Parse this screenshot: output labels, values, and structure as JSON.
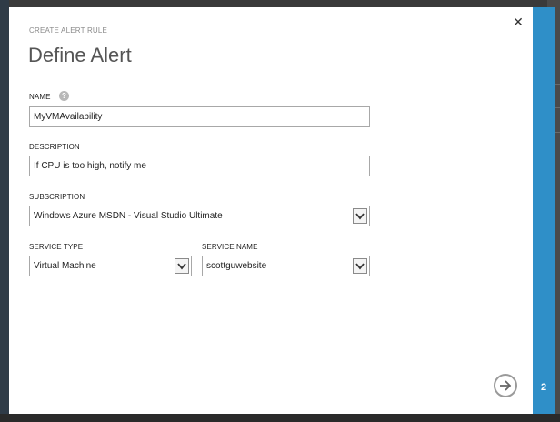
{
  "dialog": {
    "subtitle": "CREATE ALERT RULE",
    "title": "Define Alert",
    "step": "2"
  },
  "form": {
    "name": {
      "label": "NAME",
      "value": "MyVMAvailability"
    },
    "description": {
      "label": "DESCRIPTION",
      "value": "If CPU is too high, notify me"
    },
    "subscription": {
      "label": "SUBSCRIPTION",
      "value": "Windows Azure MSDN - Visual Studio Ultimate"
    },
    "service_type": {
      "label": "SERVICE TYPE",
      "value": "Virtual Machine"
    },
    "service_name": {
      "label": "SERVICE NAME",
      "value": "scottguwebsite"
    }
  },
  "icons": {
    "close": "close-icon",
    "help": "help-icon",
    "next": "arrow-right-icon",
    "dropdown": "chevron-down-icon"
  },
  "colors": {
    "accent": "#2f8fc8",
    "title_text": "#555555"
  }
}
